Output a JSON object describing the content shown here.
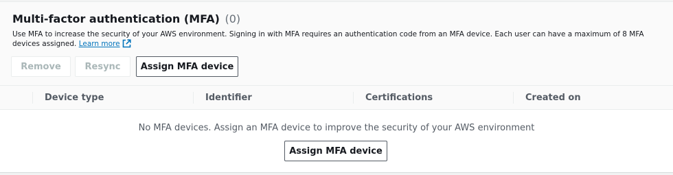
{
  "mfa": {
    "title": "Multi-factor authentication (MFA)",
    "count": "(0)",
    "description": "Use MFA to increase the security of your AWS environment. Signing in with MFA requires an authentication code from an MFA device. Each user can have a maximum of 8 MFA devices assigned.",
    "learn_more": "Learn more"
  },
  "actions": {
    "remove": "Remove",
    "resync": "Resync",
    "assign": "Assign MFA device"
  },
  "table": {
    "columns": [
      "Device type",
      "Identifier",
      "Certifications",
      "Created on"
    ],
    "empty_message": "No MFA devices. Assign an MFA device to improve the security of your AWS environment",
    "empty_action": "Assign MFA device"
  },
  "colors": {
    "link": "#0073bb",
    "text": "#16191f",
    "muted": "#545b64",
    "disabled": "#aab7b8"
  }
}
